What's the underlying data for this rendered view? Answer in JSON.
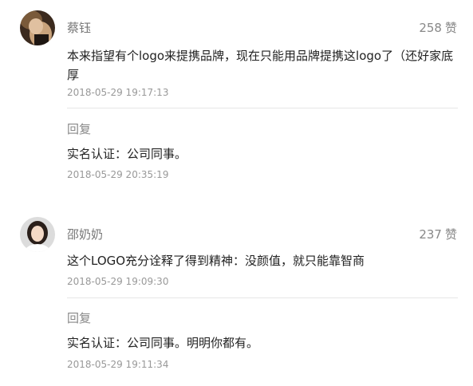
{
  "comments": [
    {
      "username": "蔡钰",
      "likes": "258",
      "like_label": "赞",
      "text": "本来指望有个logo来提携品牌，现在只能用品牌提携这logo了（还好家底厚",
      "time": "2018-05-29 19:17:13",
      "reply": {
        "label": "回复",
        "text": "实名认证：公司同事。",
        "time": "2018-05-29 20:35:19"
      }
    },
    {
      "username": "邵奶奶",
      "likes": "237",
      "like_label": "赞",
      "text": "这个LOGO充分诠释了得到精神：没颜值，就只能靠智商",
      "time": "2018-05-29 19:09:30",
      "reply": {
        "label": "回复",
        "text": "实名认证：公司同事。明明你都有。",
        "time": "2018-05-29 19:11:34"
      }
    }
  ],
  "colors": {
    "username": "#777777",
    "body_text": "#222222",
    "timestamp": "#999999",
    "divider": "#e6e6e6"
  }
}
